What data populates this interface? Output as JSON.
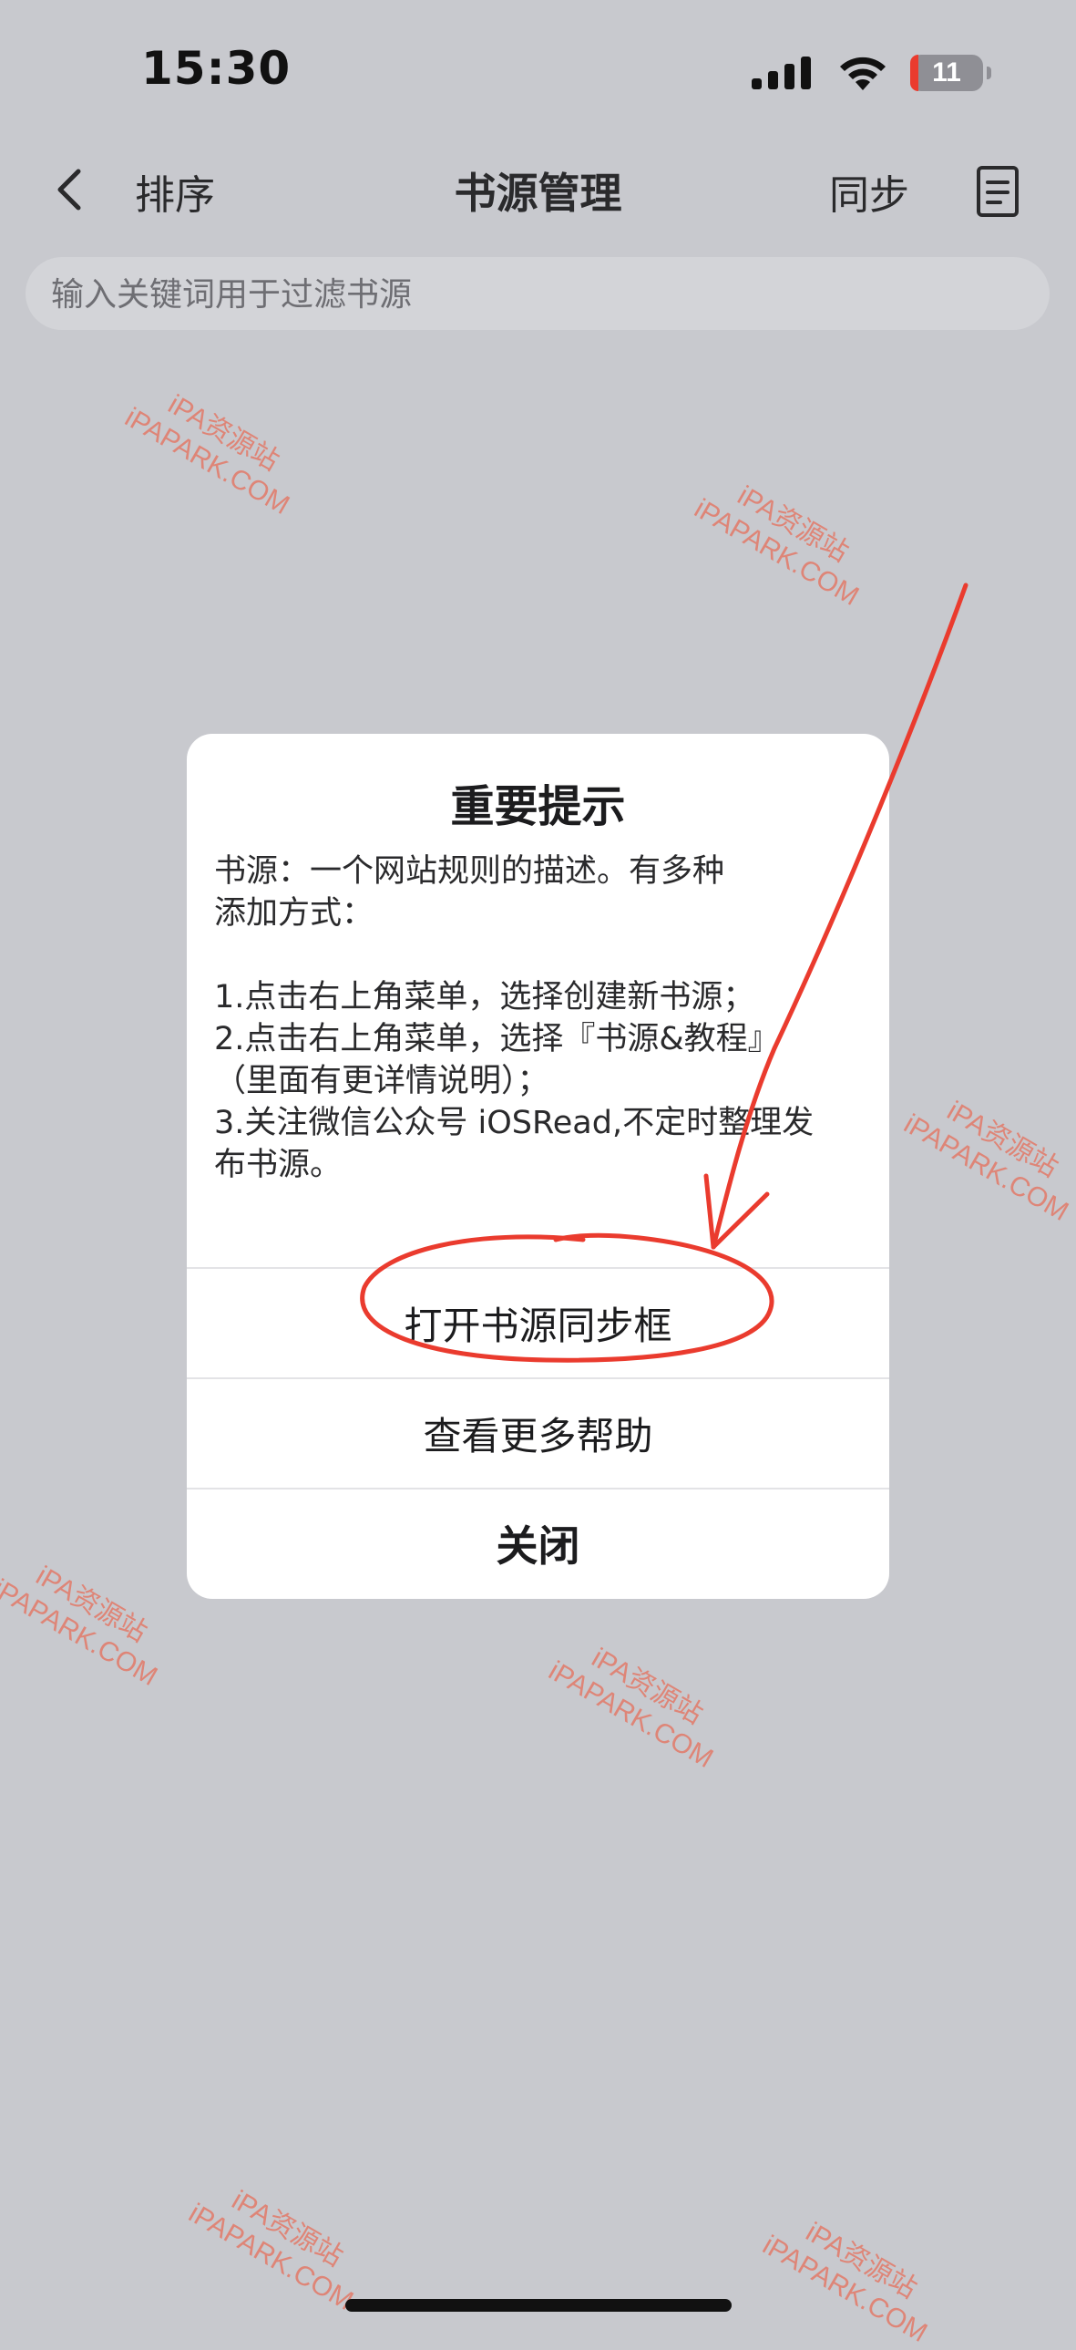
{
  "status_bar": {
    "time": "15:30",
    "battery_level": "11",
    "battery_fraction": 0.11,
    "battery_color": "#ea3b2e",
    "icons": [
      "cellular-signal-icon",
      "wifi-icon",
      "battery-icon"
    ]
  },
  "nav": {
    "back_icon": "chevron-left-icon",
    "sort_label": "排序",
    "title": "书源管理",
    "sync_label": "同步",
    "doc_icon": "document-list-icon"
  },
  "search": {
    "placeholder": "输入关键词用于过滤书源",
    "value": ""
  },
  "dialog": {
    "title": "重要提示",
    "intro_lines": [
      "书源：一个网站规则的描述。有多种",
      "添加方式："
    ],
    "steps": [
      "1.点击右上角菜单，选择创建新书源；",
      "2.点击右上角菜单，选择『书源&教程』",
      "（里面有更详情说明）；",
      "3.关注微信公众号 iOSRead,不定时整理发",
      "布书源。"
    ],
    "buttons": {
      "open_sync": "打开书源同步框",
      "more_help": "查看更多帮助",
      "close": "关闭"
    }
  },
  "watermark": {
    "line1": "iPA资源站",
    "line2": "iPAPARK.COM",
    "color": "#ee583e"
  },
  "annotation": {
    "color": "#ea3b2e",
    "shapes": [
      "arrow-annotation",
      "circle-annotation"
    ]
  }
}
